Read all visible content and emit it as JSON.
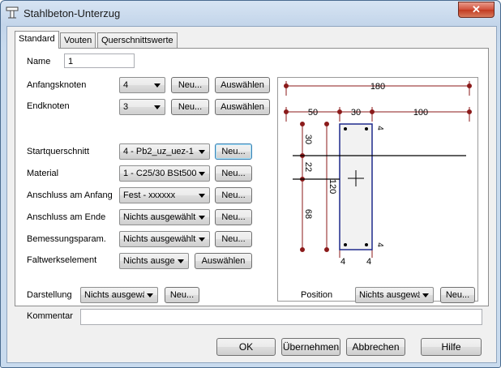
{
  "window": {
    "title": "Stahlbeton-Unterzug",
    "close_glyph": "✕"
  },
  "tabs": [
    {
      "label": "Standard"
    },
    {
      "label": "Vouten"
    },
    {
      "label": "Querschnittswerte"
    }
  ],
  "form": {
    "name_label": "Name",
    "name_value": "1",
    "anfangsknoten_label": "Anfangsknoten",
    "anfangsknoten_value": "4",
    "endknoten_label": "Endknoten",
    "endknoten_value": "3",
    "startquerschnitt_label": "Startquerschnitt",
    "startquerschnitt_value": "4 - Pb2_uz_uez-1",
    "material_label": "Material",
    "material_value": "1 - C25/30 BSt500",
    "anschluss_anfang_label": "Anschluss am Anfang",
    "anschluss_anfang_value": "Fest - xxxxxx",
    "anschluss_ende_label": "Anschluss am Ende",
    "anschluss_ende_value": "Nichts ausgewählt",
    "bemessung_label": "Bemessungsparam.",
    "bemessung_value": "Nichts ausgewählt",
    "faltwerk_label": "Faltwerkselement",
    "faltwerk_value": "Nichts ausge",
    "new_label": "Neu...",
    "select_label": "Auswählen"
  },
  "bottom": {
    "darstellung_label": "Darstellung",
    "darstellung_value": "Nichts ausgewä",
    "position_label": "Position",
    "position_value": "Nichts ausgewä",
    "kommentar_label": "Kommentar",
    "kommentar_value": "",
    "new_label": "Neu..."
  },
  "buttons": {
    "ok": "OK",
    "apply": "Übernehmen",
    "cancel": "Abbrechen",
    "help": "Hilfe"
  },
  "section_preview": {
    "dims": {
      "top": "180",
      "left": "50",
      "mid": "30",
      "right": "100",
      "v_top": "30",
      "v_mid": "22",
      "v_bottom": "68",
      "height": "120",
      "cover_top": "4",
      "cover_bottom": "4",
      "bar_left": "4",
      "bar_right": "4"
    },
    "colors": {
      "dim_line": "#8b1a1a",
      "beam_outline": "#1f2a8c",
      "axis": "#000000"
    }
  }
}
